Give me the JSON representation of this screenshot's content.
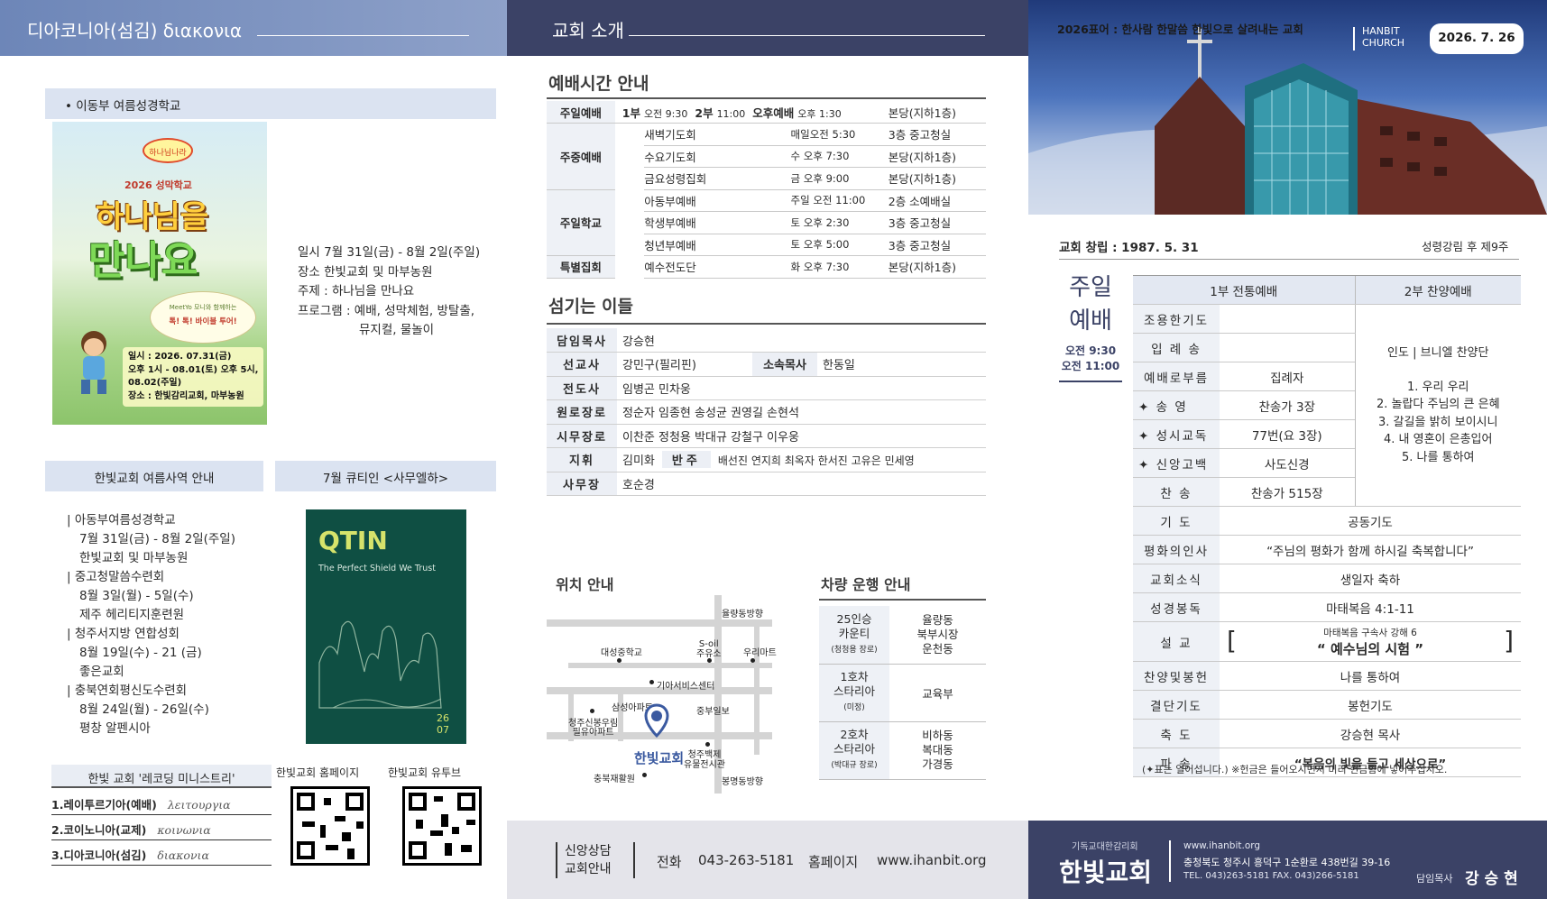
{
  "panel1": {
    "header_title": "디아코니아(섬김) διακονια",
    "camp": {
      "bullet": "• 이동부 여름성경학교",
      "poster": {
        "bubble": "하나님나라",
        "sub": "2026 성막학교",
        "title1": "하나님을",
        "title2": "만나요",
        "badge1": "MeetYo 모니와 함께하는",
        "badge2": "톡! 톡! 바이블 투어!",
        "info1": "일시 : 2026. 07.31(금)",
        "info2": "오후 1시 - 08.01(토) 오후 5시,",
        "info3": "08.02(주일)",
        "info4": "장소 : 한빛감리교회, 마부농원"
      },
      "lines": [
        "일시 7월 31일(금) - 8월 2일(주일)",
        "장소 한빛교회 및 마부농원",
        "주제 : 하나님을 만나요",
        "프로그램 : 예배, 성막체험, 방탈출,",
        "뮤지컬, 물놀이"
      ]
    },
    "summer": {
      "title": "한빛교회 여름사역 안내",
      "lines": [
        "| 아동부여름성경학교",
        "7월 31일(금) - 8월 2일(주일)",
        "한빛교회 및 마부농원",
        "| 중고청말씀수련회",
        "8월 3일(월) - 5일(수)",
        "제주 헤리티지훈련원",
        "| 청주서지방 연합성회",
        "8월 19일(수) - 21 (금)",
        "좋은교회",
        "| 충북연회평신도수련회",
        "8월 24일(월) - 26일(수)",
        "평창 알펜시아"
      ]
    },
    "qt": {
      "title": "7월 큐티인 <사무엘하>",
      "logo": "QTIN",
      "subtitle": "The Perfect Shield We Trust",
      "num1": "26",
      "num2": "07"
    },
    "ministry": {
      "title": "한빛 교회 '레코딩 미니스트리'",
      "items": [
        {
          "ko": "1.레이투르기아(예배)",
          "gr": "λειτουργια"
        },
        {
          "ko": "2.코이노니아(교제)",
          "gr": "κοινωνια"
        },
        {
          "ko": "3.디아코니아(섬김)",
          "gr": "διακονια"
        }
      ]
    },
    "qr_home": "한빛교회 홈페이지",
    "qr_youtube": "한빛교회 유투브"
  },
  "panel2": {
    "header_title": "교회 소개",
    "worship_title": "예배시간 안내",
    "sunday": {
      "label": "주일예배",
      "s1": "1부",
      "t1": "오전 9:30",
      "s2": "2부",
      "t2": "11:00",
      "s3": "오후예배",
      "t3": "오후 1:30",
      "place": "본당(지하1층)"
    },
    "weekday_label": "주중예배",
    "weekday": [
      {
        "name": "새벽기도회",
        "time": "매일오전 5:30",
        "place": "3층 중고청실"
      },
      {
        "name": "수요기도회",
        "time": "수 오후 7:30",
        "place": "본당(지하1층)"
      },
      {
        "name": "금요성령집회",
        "time": "금 오후 9:00",
        "place": "본당(지하1층)"
      }
    ],
    "school_label": "주일학교",
    "school": [
      {
        "name": "아동부예배",
        "time": "주일 오전 11:00",
        "place": "2층 소예배실"
      },
      {
        "name": "학생부예배",
        "time": "토 오후 2:30",
        "place": "3층 중고청실"
      },
      {
        "name": "청년부예배",
        "time": "토 오후 5:00",
        "place": "3층 중고청실"
      }
    ],
    "special": {
      "label": "특별집회",
      "name": "예수전도단",
      "time": "화 오후 7:30",
      "place": "본당(지하1층)"
    },
    "servers_title": "섬기는 이들",
    "servers": [
      {
        "l": "담임목사",
        "v": "강승현"
      },
      {
        "l": "선교사",
        "v": "강민구(필리핀)",
        "l2": "소속목사",
        "v2": "한동일"
      },
      {
        "l": "전도사",
        "v": "임병곤 민차웅"
      },
      {
        "l": "원로장로",
        "v": "정순자 임종현 송성균 권영길 손현석"
      },
      {
        "l": "시무장로",
        "v": "이찬준 정청용 박대규 강철구 이우웅"
      },
      {
        "l": "지휘",
        "v": "김미화",
        "l2": "반주",
        "v2": "배선진 연지희 최옥자 한서진 고유은 민세영"
      },
      {
        "l": "사무장",
        "v": "호순경"
      }
    ],
    "map_title": "위치 안내",
    "map": {
      "north": "율량동방향",
      "south": "봉명동방향",
      "school": "대성중학교",
      "soil1": "S-oil",
      "soil2": "주유소",
      "mart": "우리마트",
      "kia": "기아서비스센터",
      "samsung": "삼성아파트",
      "joongbu": "중부일보",
      "apt1": "청주신봉우림",
      "apt2": "필유아파트",
      "church": "한빛교회",
      "museum1": "청주백제",
      "museum2": "유물전시관",
      "hall": "충북재활원"
    },
    "vehicle_title": "차량 운행 안내",
    "vehicles": [
      {
        "n1": "25인승",
        "n2": "카운티",
        "n3": "(청청용 장로)",
        "areas": [
          "율량동",
          "북부시장",
          "운천동"
        ]
      },
      {
        "n1": "1호차",
        "n2": "스타리아",
        "n3": "(미정)",
        "areas": [
          "교육부"
        ]
      },
      {
        "n1": "2호차",
        "n2": "스타리아",
        "n3": "(박대규 장로)",
        "areas": [
          "비하동",
          "복대동",
          "가경동"
        ]
      }
    ],
    "footer": {
      "label1": "신앙상담",
      "label2": "교회안내",
      "phone_label": "전화",
      "phone": "043-263-5181",
      "home_label": "홈페이지",
      "home": "www.ihanbit.org"
    }
  },
  "panel3": {
    "motto": "2026표어 : 한사람 한말씀 한빛으로 살려내는 교회",
    "brand1": "HANBIT",
    "brand2": "CHURCH",
    "date": "2026. 7. 26",
    "founded": "교회 창립 : 1987. 5. 31",
    "season": "성령강림 후 제9주",
    "side1": "주일",
    "side2": "예배",
    "side_t1": "오전 9:30",
    "side_t2": "오전 11:00",
    "col1": "1부 전통예배",
    "col2": "2부 찬양예배",
    "rows_top": [
      {
        "l": "조용한기도",
        "v": "",
        "mark": false
      },
      {
        "l": "입 례 송",
        "v": "",
        "mark": false
      },
      {
        "l": "예배로부름",
        "v": "집례자",
        "mark": false
      },
      {
        "l": "송 영",
        "v": "찬송가 3장",
        "mark": true
      },
      {
        "l": "성시교독",
        "v": "77번(요 3장)",
        "mark": true
      },
      {
        "l": "신앙고백",
        "v": "사도신경",
        "mark": true
      },
      {
        "l": "찬 송",
        "v": "찬송가 515장",
        "mark": false
      }
    ],
    "praise": [
      "인도 | 브니엘 찬양단",
      "1. 우리 우리",
      "2. 놀랍다 주님의 큰 은혜",
      "3. 갈길을 밝히 보이시니",
      "4. 내 영혼이 은총입어",
      "5. 나를 통하여"
    ],
    "rows_bottom": [
      {
        "l": "기 도",
        "v": "공동기도"
      },
      {
        "l": "평화의인사",
        "v": "“주님의 평화가 함께 하시길 축복합니다”"
      },
      {
        "l": "교회소식",
        "v": "생일자 축하"
      },
      {
        "l": "성경봉독",
        "v": "마태복음 4:1-11"
      }
    ],
    "sermon": {
      "l": "설 교",
      "sub": "마태복음 구속사 강해 6",
      "title": "“ 예수님의 시험 ”"
    },
    "rows_end": [
      {
        "l": "찬양및봉헌",
        "v": "나를 통하여"
      },
      {
        "l": "결단기도",
        "v": "봉헌기도"
      },
      {
        "l": "축 도",
        "v": "강승현 목사"
      },
      {
        "l": "파 송",
        "v": "“복음의 빛을 들고 세상으로”"
      }
    ],
    "note": "(✦표는 일어섭니다.) ※헌금은 들어오시면서 미리 헌금함에 넣어주십시오.",
    "footer": {
      "denom": "기독교대한감리회",
      "name": "한빛교회",
      "web": "www.ihanbit.org",
      "addr": "충청북도 청주시 흥덕구 1순환로 438번길 39-16",
      "tel": "TEL. 043)263-5181   FAX. 043)266-5181",
      "pastor_label": "담임목사",
      "pastor": "강 승 현"
    }
  },
  "colors": {
    "header_left": "#6d86b8",
    "header_mid": "#3b4266",
    "footer_right": "#3b4266",
    "footer_mid": "#e4e4ea",
    "accent_light": "#dbe3f1"
  }
}
